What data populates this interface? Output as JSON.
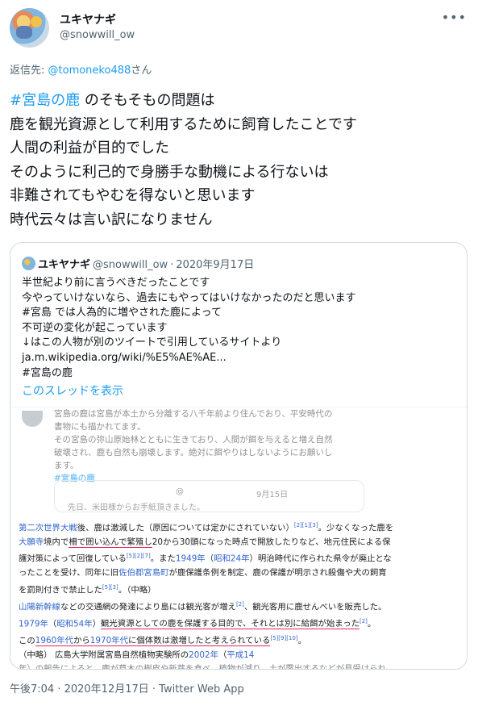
{
  "author": {
    "name": "ユキヤナギ",
    "handle": "@snowwill_ow"
  },
  "reply": {
    "prefix": "返信先: ",
    "mention": "@tomoneko488",
    "suffix": "さん"
  },
  "tweet": {
    "hashtag": "#宮島の鹿",
    "first_line_rest": " のそもそもの問題は",
    "lines": [
      "鹿を観光資源として利用するために飼育したことです",
      "人間の利益が目的でした",
      "そのように利己的で身勝手な動機による行ないは",
      "非難されてもやむを得ないと思います",
      "時代云々は言い訳になりません"
    ]
  },
  "quote": {
    "name": "ユキヤナギ",
    "handle": "@snowwill_ow",
    "date": "2020年9月17日",
    "lines": [
      "半世紀より前に言うべきだったことです",
      "今やっていけないなら、過去にもやってはいけなかったのだと思います",
      "#宮島 では人為的に増やされた鹿によって",
      "不可逆の変化が起こっています",
      "↓はこの人物が別のツイートで引用しているサイトより",
      "ja.m.wikipedia.org/wiki/%E5%AE%AE...",
      "#宮島の鹿"
    ],
    "show_thread": "このスレッドを表示",
    "screenshot": {
      "top_lines": [
        "宮島の鹿は宮島が本土から分離する八千年前より住んでおり、平安時代の",
        "書物にも描かれてます。",
        "その宮島の弥山原始林とともに生きており、人間が餌を与えると増え自然",
        "破壊され、鹿も自然も崩壊します。絶対に餌やりはしないようにお願いし",
        "ます。"
      ],
      "top_tag": "#宮島の鹿",
      "card_at": "@",
      "card_date": "9月15日",
      "card_text": "先日、米田様からお手紙頂きました。",
      "wiki": {
        "l1": [
          "第二次世界大戦",
          "後、鹿は激減した（原因については定かにされていない）",
          "[2][1][3]",
          "。少なくなった鹿を"
        ],
        "l2": [
          "大願寺",
          "境内で",
          "柵で囲い込んで繁殖し",
          "20から30頭になった時点で開放したりなど、地元住民による保"
        ],
        "l3": [
          "護対策によって回復している",
          "[5][2][7]",
          "。また",
          "1949年",
          "（",
          "昭和24年",
          "）明治時代に作られた県令が廃止とな"
        ],
        "l4": [
          "ったことを受け、同年に旧",
          "佐伯郡",
          "宮島町",
          "が鹿保護条例を制定、鹿の保護が明示され殺傷や犬の飼育"
        ],
        "l5": [
          "を罰則付きで禁止した",
          "[5][3]",
          "。（中略）"
        ],
        "l6": [
          "山陽新幹線",
          "などの交通網の発達により島には観光客が増え",
          "[2]",
          "、観光客用に鹿せんべいを販売した。"
        ],
        "l7": [
          "1979年",
          "（",
          "昭和54年",
          "）",
          "観光資源としての鹿を保護する目的で、それとは別に給餌が始まった",
          "[2]",
          "。"
        ],
        "l8": [
          "この",
          "1960年代",
          "から",
          "1970年代",
          "に個体数は激増したと考えられている",
          "[5][9][10]",
          "。"
        ],
        "l9": [
          "（中略）",
          "広島大学附属宮島自然植物実験所の",
          "2002年",
          "（",
          "平成14"
        ],
        "l10": [
          "年）の報告によると、鹿が草木の樹皮や新芽を食べ、植物が減り、土が露出するなどが見受けられ"
        ]
      }
    }
  },
  "footer": {
    "timestamp": "午後7:04 · 2020年12月17日 · Twitter Web App"
  }
}
